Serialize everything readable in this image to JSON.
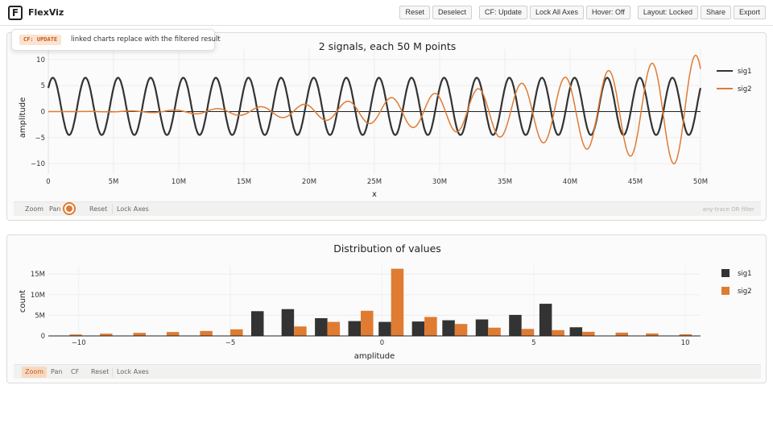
{
  "app": {
    "name": "FlexViz",
    "logo_letter": "F"
  },
  "toolbar": [
    {
      "id": "reset",
      "label": "Reset"
    },
    {
      "id": "deselect",
      "label": "Deselect"
    },
    {
      "id": "cf",
      "label": "CF: Update"
    },
    {
      "id": "lock-all",
      "label": "Lock All Axes"
    },
    {
      "id": "hover",
      "label": "Hover: Off"
    },
    {
      "id": "layout",
      "label": "Layout: Locked"
    },
    {
      "id": "share",
      "label": "Share"
    },
    {
      "id": "export",
      "label": "Export"
    }
  ],
  "tooltip": {
    "badge": "CF: UPDATE",
    "text": "linked charts replace with the filtered result"
  },
  "colors": {
    "sig1": "#333333",
    "sig2": "#e07b32",
    "accent": "#e07b32"
  },
  "panel1": {
    "controls": [
      "Zoom",
      "Pan",
      "Reset",
      "Lock Axes"
    ],
    "filter_note": "any-trace OR filter"
  },
  "panel2": {
    "controls": [
      "Zoom",
      "Pan",
      "CF",
      "Reset",
      "Lock Axes"
    ],
    "active_control": "Zoom"
  },
  "chart_data": [
    {
      "type": "line",
      "title": "2 signals, each 50 M points",
      "xlabel": "x",
      "ylabel": "amplitude",
      "xlim": [
        0,
        50000000
      ],
      "ylim": [
        -12,
        12
      ],
      "xticks": [
        0,
        5000000,
        10000000,
        15000000,
        20000000,
        25000000,
        30000000,
        35000000,
        40000000,
        45000000,
        50000000
      ],
      "xtick_labels": [
        "0",
        "5M",
        "10M",
        "15M",
        "20M",
        "25M",
        "30M",
        "35M",
        "40M",
        "45M",
        "50M"
      ],
      "yticks": [
        10,
        5,
        0,
        -5,
        -10
      ],
      "ytick_labels": [
        "10",
        "5",
        "0",
        "−5",
        "−10"
      ],
      "legend_position": "right",
      "series": [
        {
          "name": "sig1",
          "description": "offset sine, ~20 cycles, range -4.5 to 6.5",
          "offset": 1,
          "amplitude": 5.5,
          "cycles": 20
        },
        {
          "name": "sig2",
          "description": "growing oscillation, ~15 cycles, amplitude rising to ~11",
          "cycles": 15,
          "amplitude_end": 11
        }
      ]
    },
    {
      "type": "bar",
      "title": "Distribution of values",
      "xlabel": "amplitude",
      "ylabel": "count",
      "xlim": [
        -11,
        10.5
      ],
      "ylim": [
        0,
        17000000
      ],
      "xticks": [
        -10,
        -5,
        0,
        5,
        10
      ],
      "xtick_labels": [
        "−10",
        "−5",
        "0",
        "5",
        "10"
      ],
      "yticks": [
        0,
        5000000,
        10000000,
        15000000
      ],
      "ytick_labels": [
        "0",
        "5M",
        "10M",
        "15M"
      ],
      "legend_position": "right",
      "bin_centers": [
        -10.3,
        -9.3,
        -8.2,
        -7.1,
        -6.0,
        -5.0,
        -3.9,
        -2.9,
        -1.8,
        -0.7,
        0.3,
        1.4,
        2.4,
        3.5,
        4.6,
        5.6,
        6.6,
        7.7,
        8.7,
        9.8
      ],
      "series": [
        {
          "name": "sig1",
          "values": [
            0,
            0,
            0,
            0,
            0,
            0,
            6000000,
            6500000,
            4300000,
            3600000,
            3400000,
            3500000,
            3800000,
            4000000,
            5100000,
            7800000,
            2100000,
            0,
            0,
            0
          ]
        },
        {
          "name": "sig2",
          "values": [
            350000,
            550000,
            750000,
            950000,
            1200000,
            1600000,
            0,
            2300000,
            3400000,
            6100000,
            16300000,
            4600000,
            2900000,
            2000000,
            1700000,
            1400000,
            1000000,
            800000,
            600000,
            400000
          ]
        }
      ]
    }
  ]
}
